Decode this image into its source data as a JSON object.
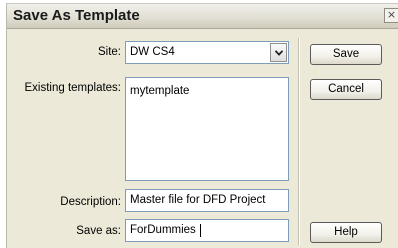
{
  "window": {
    "title": "Save As Template",
    "close_symbol": "×"
  },
  "form": {
    "site_label": "Site:",
    "site_value": "DW CS4",
    "existing_label": "Existing templates:",
    "existing_templates": [
      "mytemplate"
    ],
    "description_label": "Description:",
    "description_value": "Master file for DFD Project",
    "save_as_label": "Save as:",
    "save_as_value": "ForDummies"
  },
  "buttons": {
    "save": "Save",
    "cancel": "Cancel",
    "help": "Help"
  },
  "icons": {
    "dropdown": "chevron-down-icon",
    "close": "close-icon"
  }
}
